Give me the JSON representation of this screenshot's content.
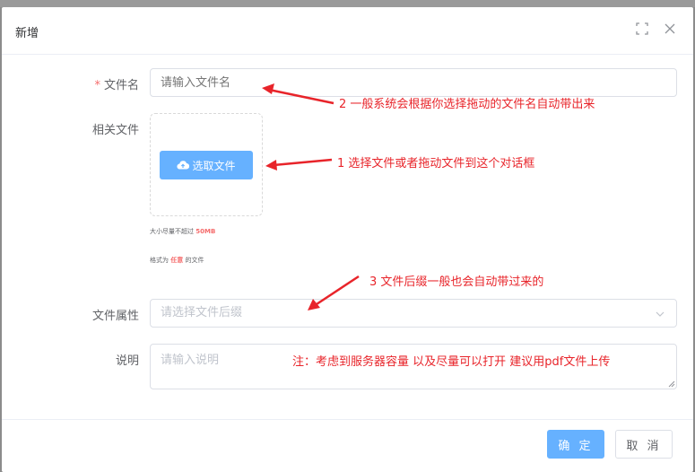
{
  "dialog": {
    "title": "新增"
  },
  "form": {
    "filename": {
      "label": "文件名",
      "required_mark": "*",
      "placeholder": "请输入文件名"
    },
    "related_file": {
      "label": "相关文件",
      "upload_button": "选取文件",
      "tip_size_prefix": "大小尽量不超过",
      "tip_size_value": "50MB",
      "tip_format_prefix": "格式为",
      "tip_format_value": "任意",
      "tip_format_suffix": "的文件"
    },
    "file_attr": {
      "label": "文件属性",
      "placeholder": "请选择文件后缀"
    },
    "description": {
      "label": "说明",
      "placeholder": "请输入说明"
    }
  },
  "footer": {
    "ok_label": "确 定",
    "cancel_label": "取 消"
  },
  "annotations": {
    "a1": "1 选择文件或者拖动文件到这个对话框",
    "a2": "2 一般系统会根据你选择拖动的文件名自动带出来",
    "a3": "3 文件后缀一般也会自动带过来的",
    "note": "注：考虑到服务器容量 以及尽量可以打开 建议用pdf文件上传"
  },
  "colors": {
    "primary": "#66b1ff",
    "annotation": "#e8242a",
    "required": "#f56c6c"
  },
  "icons": {
    "fullscreen": "fullscreen-icon",
    "close": "close-icon",
    "upload": "cloud-upload-icon",
    "dropdown": "chevron-down-icon"
  }
}
